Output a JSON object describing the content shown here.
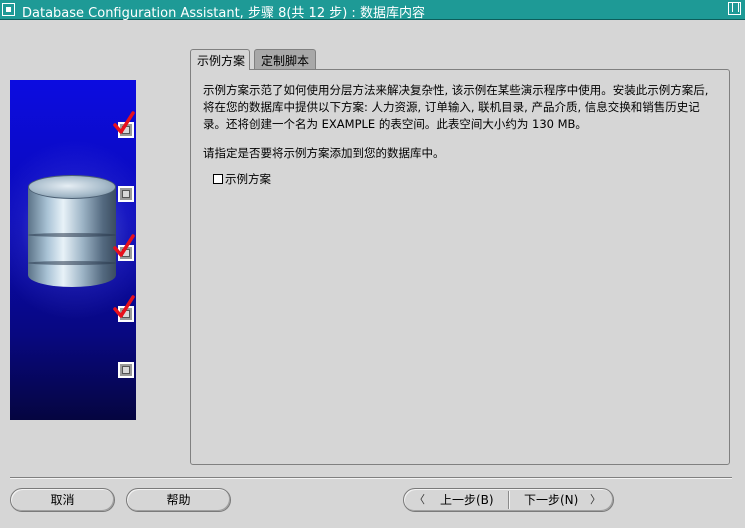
{
  "window": {
    "title": "Database Configuration Assistant, 步骤 8(共 12 步) : 数据库内容"
  },
  "tabs": [
    {
      "label": "示例方案",
      "active": true
    },
    {
      "label": "定制脚本",
      "active": false
    }
  ],
  "content": {
    "description": "示例方案示范了如何使用分层方法来解决复杂性, 该示例在某些演示程序中使用。安装此示例方案后, 将在您的数据库中提供以下方案: 人力资源, 订单输入, 联机目录, 产品介质, 信息交换和销售历史记录。还将创建一个名为 EXAMPLE 的表空间。此表空间大小约为 130 MB。",
    "prompt": "请指定是否要将示例方案添加到您的数据库中。",
    "checkbox_label": "示例方案",
    "checkbox_checked": false
  },
  "progress_steps": [
    {
      "checked": true
    },
    {
      "checked": false
    },
    {
      "checked": true
    },
    {
      "checked": true
    },
    {
      "checked": false
    }
  ],
  "buttons": {
    "cancel": "取消",
    "help": "帮助",
    "back": "上一步(B)",
    "next": "下一步(N)"
  },
  "colors": {
    "titlebar": "#1e9a96",
    "panel": "#d6d6d6",
    "check": "#e8101c"
  }
}
